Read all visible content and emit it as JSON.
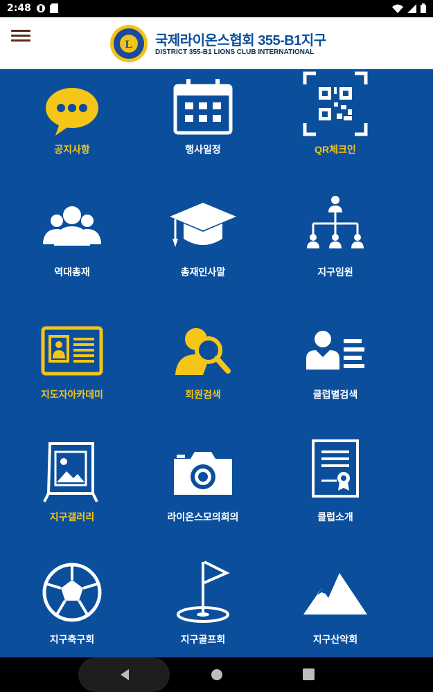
{
  "status": {
    "time": "2:48"
  },
  "header": {
    "title": "국제라이온스협회 355-B1지구",
    "subtitle": "DISTRICT 355-B1 LIONS CLUB INTERNATIONAL",
    "logo_letter": "L"
  },
  "colors": {
    "background": "#0b4f9c",
    "yellow": "#f5c518",
    "white": "#ffffff",
    "title": "#0b4f9c"
  },
  "tiles": [
    {
      "label": "공지사항",
      "icon": "speech-bubble-icon",
      "color": "yellow"
    },
    {
      "label": "행사일정",
      "icon": "calendar-icon",
      "color": "white"
    },
    {
      "label": "QR체크인",
      "icon": "qr-code-icon",
      "color": "yellow"
    },
    {
      "label": "역대총재",
      "icon": "group-people-icon",
      "color": "white"
    },
    {
      "label": "총재인사말",
      "icon": "graduation-cap-icon",
      "color": "white"
    },
    {
      "label": "지구임원",
      "icon": "org-chart-icon",
      "color": "white"
    },
    {
      "label": "지도자아카데미",
      "icon": "id-card-icon",
      "color": "yellow"
    },
    {
      "label": "회원검색",
      "icon": "person-search-icon",
      "color": "yellow"
    },
    {
      "label": "클럽별검색",
      "icon": "person-list-icon",
      "color": "white"
    },
    {
      "label": "지구갤러리",
      "icon": "picture-frame-icon",
      "color": "yellow"
    },
    {
      "label": "라이온스모의회의",
      "icon": "camera-icon",
      "color": "white"
    },
    {
      "label": "클럽소개",
      "icon": "certificate-icon",
      "color": "white"
    },
    {
      "label": "지구축구회",
      "icon": "soccer-ball-icon",
      "color": "white"
    },
    {
      "label": "지구골프회",
      "icon": "golf-flag-icon",
      "color": "white"
    },
    {
      "label": "지구산악회",
      "icon": "mountain-icon",
      "color": "white"
    }
  ]
}
